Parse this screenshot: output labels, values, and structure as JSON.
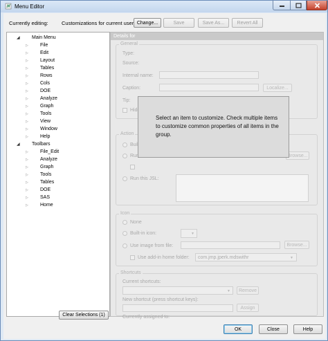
{
  "window": {
    "title": "Menu Editor"
  },
  "top": {
    "editing_label": "Currently editing:",
    "editing_value": "Customizations for current user",
    "change_label": "Change...",
    "save_label": "Save",
    "save_as_label": "Save As...",
    "revert_all_label": "Revert All"
  },
  "tree": {
    "items": [
      {
        "label": "Main Menu",
        "level": 0,
        "expanded": true
      },
      {
        "label": "File",
        "level": 1
      },
      {
        "label": "Edit",
        "level": 1
      },
      {
        "label": "Layout",
        "level": 1
      },
      {
        "label": "Tables",
        "level": 1
      },
      {
        "label": "Rows",
        "level": 1
      },
      {
        "label": "Cols",
        "level": 1
      },
      {
        "label": "DOE",
        "level": 1
      },
      {
        "label": "Analyze",
        "level": 1
      },
      {
        "label": "Graph",
        "level": 1
      },
      {
        "label": "Tools",
        "level": 1
      },
      {
        "label": "View",
        "level": 1
      },
      {
        "label": "Window",
        "level": 1
      },
      {
        "label": "Help",
        "level": 1
      },
      {
        "label": "Toolbars",
        "level": 0,
        "expanded": true
      },
      {
        "label": "File_Edit",
        "level": 1
      },
      {
        "label": "Analyze",
        "level": 1
      },
      {
        "label": "Graph",
        "level": 1
      },
      {
        "label": "Tools",
        "level": 1
      },
      {
        "label": "Tables",
        "level": 1
      },
      {
        "label": "DOE",
        "level": 1
      },
      {
        "label": "SAS",
        "level": 1
      },
      {
        "label": "Home",
        "level": 1
      }
    ],
    "clear_selections_label": "Clear Selections (1)"
  },
  "details": {
    "header": "Details for",
    "general": {
      "title": "General",
      "type_label": "Type:",
      "source_label": "Source:",
      "internal_name_label": "Internal name:",
      "caption_label": "Caption:",
      "localize_label": "Localize...",
      "tip_label": "Tip:",
      "hide_label": "Hide"
    },
    "action": {
      "title": "Action",
      "built_label": "Built",
      "run_label": "Run",
      "run_jsl_label": "Run this JSL:",
      "browse_label": "Browse..."
    },
    "icon": {
      "title": "Icon",
      "none_label": "None",
      "builtin_label": "Built-in icon:",
      "use_image_label": "Use image from file:",
      "browse_label": "Browse...",
      "addin_label": "Use add-in home folder:",
      "addin_value": "com.jmp.jperk.mdswithr"
    },
    "shortcuts": {
      "title": "Shortcuts",
      "current_label": "Current shortcuts:",
      "remove_label": "Remove",
      "new_label": "New shortcut (press shortcut keys):",
      "assign_label": "Assign",
      "assigned_label": "Currently assigned to:"
    },
    "overlay_message": "Select an item to customize. Check multiple items to customize common properties of all items in the group."
  },
  "footer": {
    "ok_label": "OK",
    "close_label": "Close",
    "help_label": "Help"
  },
  "colors": {
    "titlebar": "#c3d6ee",
    "close_button": "#c4412b",
    "dialog_bg": "#f0f0f0",
    "details_bg": "#e9e9e9"
  }
}
